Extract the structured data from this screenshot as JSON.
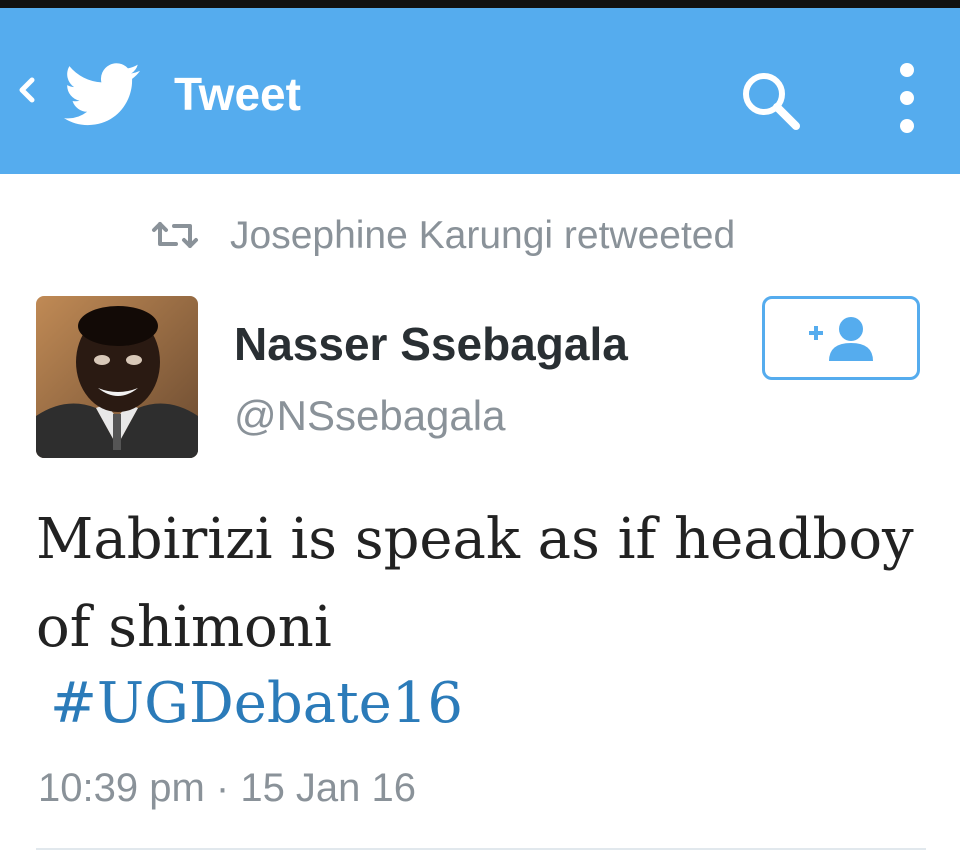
{
  "appbar": {
    "title": "Tweet",
    "back_icon": "chevron-left-icon",
    "logo_icon": "twitter-bird-icon",
    "search_icon": "search-icon",
    "more_icon": "more-vertical-icon",
    "background_color": "#55acee"
  },
  "retweet": {
    "icon": "retweet-icon",
    "text": "Josephine Karungi retweeted"
  },
  "author": {
    "name": "Nasser Ssebagala",
    "handle": "@NSsebagala",
    "follow_icon": "add-user-icon"
  },
  "tweet": {
    "line1": "Mabirizi is speak as if headboy",
    "line2": "of shimoni",
    "hashtag": "#UGDebate16",
    "time": "10:39 pm",
    "separator": " · ",
    "date": "15 Jan 16"
  },
  "colors": {
    "accent": "#55acee",
    "hashtag": "#2b7bb9",
    "muted_text": "#8a9299"
  }
}
